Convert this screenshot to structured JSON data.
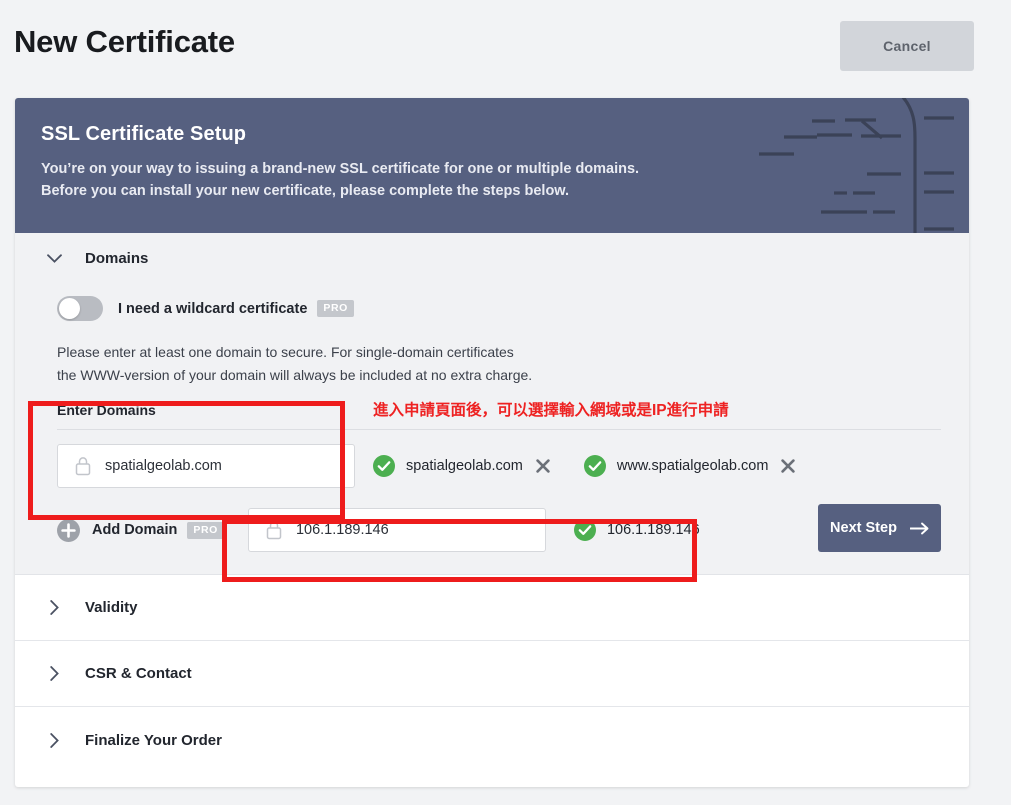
{
  "topbar": {
    "title": "New Certificate",
    "cancel_label": "Cancel"
  },
  "card_header": {
    "title": "SSL Certificate Setup",
    "line1": "You’re on your way to issuing a brand-new SSL certificate for one or multiple domains.",
    "line2": "Before you can install your new certificate, please complete the steps below."
  },
  "domains_section": {
    "label": "Domains",
    "expanded": true,
    "wildcard": {
      "label": "I need a wildcard certificate",
      "badge": "PRO",
      "enabled": false
    },
    "helper_line1": "Please enter at least one domain to secure. For single-domain certificates",
    "helper_line2": "the WWW-version of your domain will always be included at no extra charge.",
    "enter_domains_label": "Enter Domains",
    "domain_input": {
      "value": "spatialgeolab.com",
      "placeholder": "example.com"
    },
    "domain_chips": [
      {
        "label": "spatialgeolab.com",
        "valid": true
      },
      {
        "label": "www.spatialgeolab.com",
        "valid": true
      }
    ],
    "add_domain": {
      "label": "Add Domain",
      "badge": "PRO"
    },
    "ip_input": {
      "value": "106.1.189.146",
      "placeholder": "example.com"
    },
    "ip_chips": [
      {
        "label": "106.1.189.146",
        "valid": true
      }
    ],
    "next_step_label": "Next Step"
  },
  "collapsed_sections": [
    {
      "label": "Validity"
    },
    {
      "label": "CSR & Contact"
    },
    {
      "label": "Finalize Your Order"
    }
  ],
  "annotations": {
    "chinese_note": "進入申請頁面後，可以選擇輸入網域或是IP進行申請"
  },
  "colors": {
    "banner": "#566080",
    "accent": "#566080",
    "annotation_red": "#ee1c1c",
    "valid_green": "#4caf50",
    "page_bg": "#f2f3f5",
    "section_bg": "#f1f2f4",
    "cancel_bg": "#d2d5da"
  }
}
